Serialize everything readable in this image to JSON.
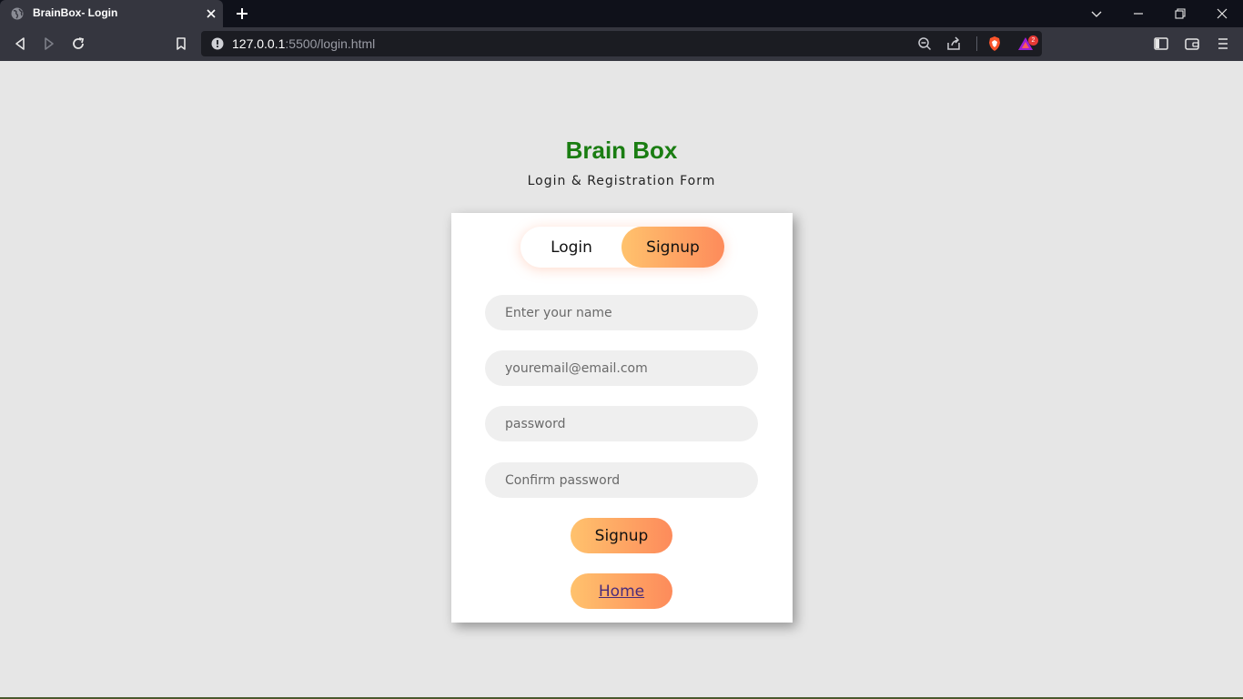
{
  "browser": {
    "tab_title": "BrainBox- Login",
    "url_host": "127.0.0.1",
    "url_path": ":5500/login.html",
    "notification_count": "2",
    "icons": [
      "globe-icon",
      "close-icon",
      "plus-icon",
      "chevron-down-icon",
      "minimize-icon",
      "restore-icon",
      "window-close-icon",
      "back-icon",
      "forward-icon",
      "reload-icon",
      "bookmark-icon",
      "info-icon",
      "zoom-out-icon",
      "share-icon",
      "brave-shield-icon",
      "brave-rewards-icon",
      "sidebar-icon",
      "wallet-icon",
      "menu-icon"
    ]
  },
  "page": {
    "brand": "Brain Box",
    "subtitle": "Login & Registration Form",
    "tabs": {
      "login": "Login",
      "signup": "Signup",
      "active": "signup"
    },
    "form": {
      "name_placeholder": "Enter your name",
      "email_placeholder": "youremail@email.com",
      "password_placeholder": "password",
      "confirm_placeholder": "Confirm password",
      "submit_label": "Signup",
      "home_label": "Home"
    }
  },
  "colors": {
    "brand": "#1a7d12",
    "gradient_start": "#ffc26d",
    "gradient_end": "#fd8b5b",
    "page_bg": "#e6e6e6",
    "input_bg": "#efefef"
  }
}
